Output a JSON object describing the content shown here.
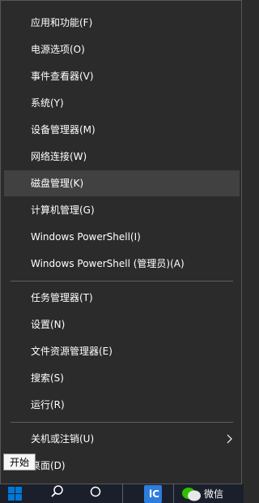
{
  "context_menu": {
    "group1": [
      {
        "id": "apps",
        "label": "应用和功能(F)"
      },
      {
        "id": "power",
        "label": "电源选项(O)"
      },
      {
        "id": "event-viewer",
        "label": "事件查看器(V)"
      },
      {
        "id": "system",
        "label": "系统(Y)"
      },
      {
        "id": "device-manager",
        "label": "设备管理器(M)"
      },
      {
        "id": "network",
        "label": "网络连接(W)"
      },
      {
        "id": "disk-management",
        "label": "磁盘管理(K)",
        "highlighted": true
      },
      {
        "id": "computer-management",
        "label": "计算机管理(G)"
      },
      {
        "id": "powershell",
        "label": "Windows PowerShell(I)"
      },
      {
        "id": "powershell-admin",
        "label": "Windows PowerShell (管理员)(A)"
      }
    ],
    "group2": [
      {
        "id": "task-manager",
        "label": "任务管理器(T)"
      },
      {
        "id": "settings",
        "label": "设置(N)"
      },
      {
        "id": "file-explorer",
        "label": "文件资源管理器(E)"
      },
      {
        "id": "search",
        "label": "搜索(S)"
      },
      {
        "id": "run",
        "label": "运行(R)"
      }
    ],
    "group3": [
      {
        "id": "shutdown",
        "label": "关机或注销(U)",
        "submenu": true
      },
      {
        "id": "desktop",
        "label": "桌面(D)"
      }
    ]
  },
  "tooltip": {
    "text": "开始"
  },
  "taskbar": {
    "wechat_label": "微信",
    "app_glyph": "lC"
  },
  "colors": {
    "menu_background": "#2b2b2b",
    "highlight": "#414141",
    "text": "#ffffff",
    "windows_logo": "#0078d7",
    "wechat": "#2dc100"
  }
}
